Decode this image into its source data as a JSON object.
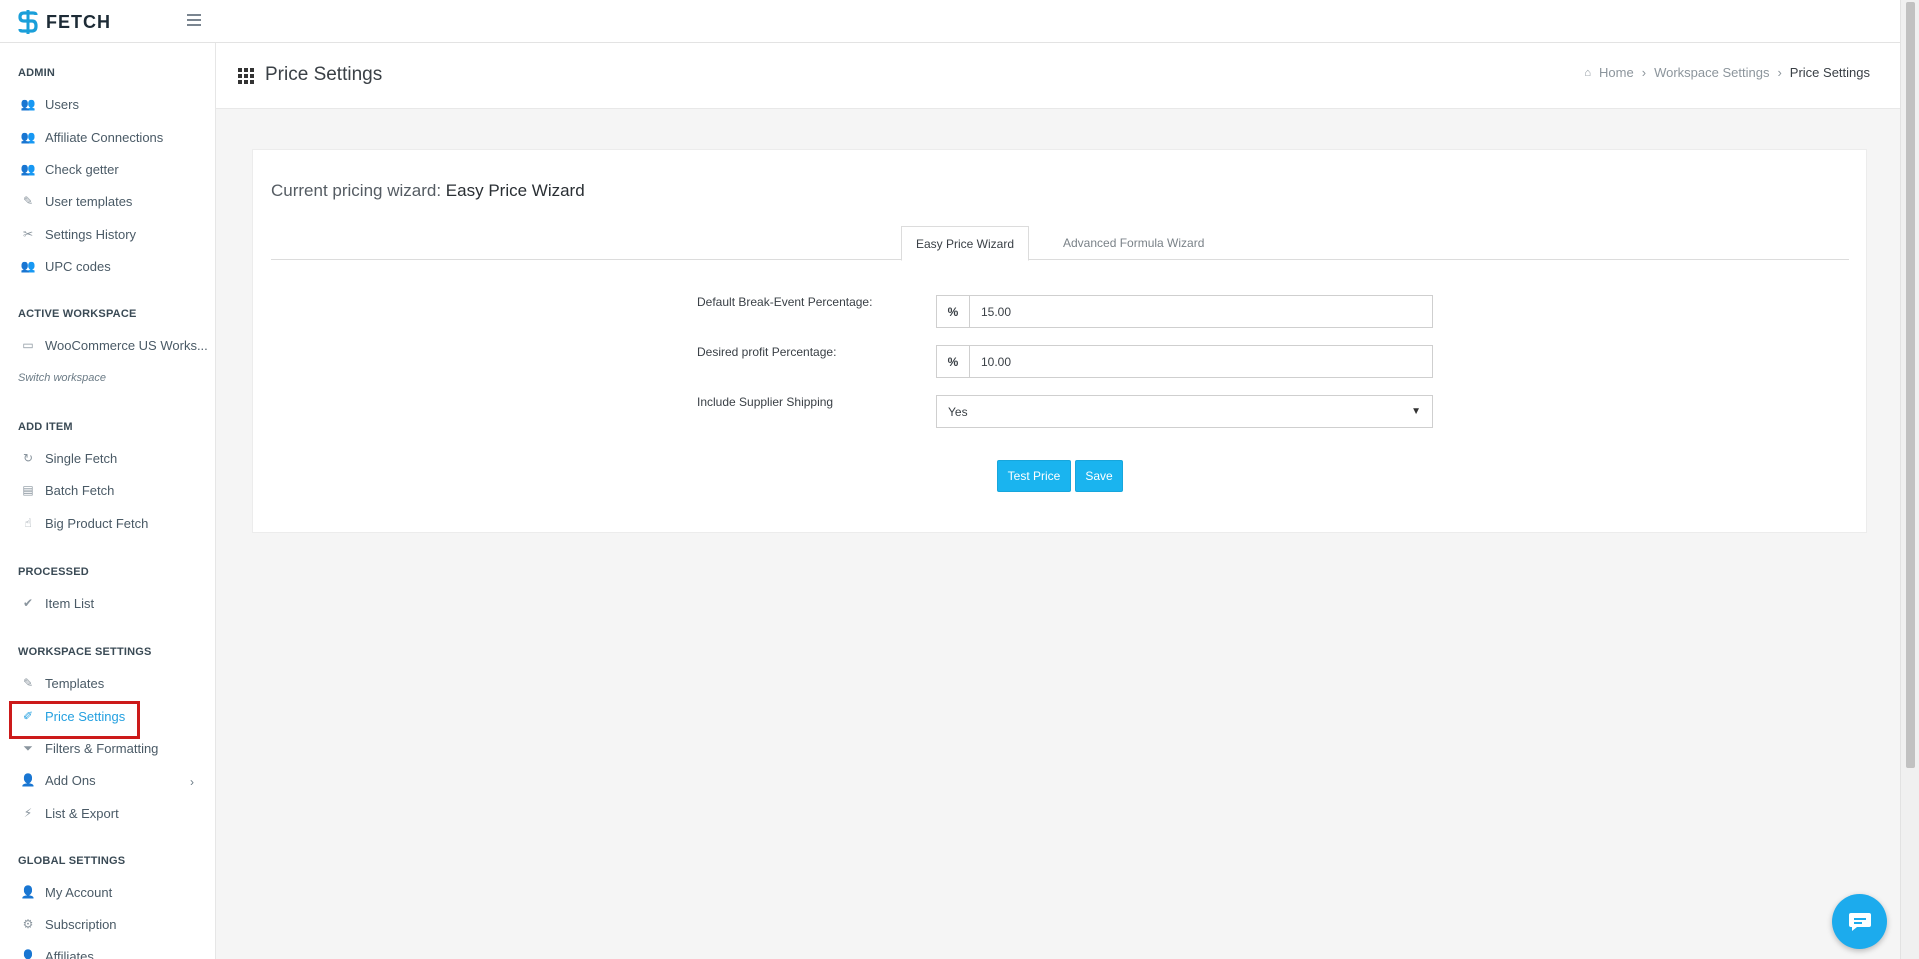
{
  "app": {
    "brand": "FETCH"
  },
  "sidebar": {
    "admin": {
      "title": "ADMIN",
      "items": [
        {
          "label": "Users",
          "icon": "users-icon"
        },
        {
          "label": "Affiliate Connections",
          "icon": "users-icon"
        },
        {
          "label": "Check getter",
          "icon": "users-icon"
        },
        {
          "label": "User templates",
          "icon": "brush-icon"
        },
        {
          "label": "Settings History",
          "icon": "tools-icon"
        },
        {
          "label": "UPC codes",
          "icon": "users-icon"
        }
      ]
    },
    "active_workspace": {
      "title": "ACTIVE WORKSPACE",
      "workspace_name": "WooCommerce US Works...",
      "switch_label": "Switch workspace"
    },
    "add_item": {
      "title": "ADD ITEM",
      "items": [
        {
          "label": "Single Fetch",
          "icon": "rotate-icon"
        },
        {
          "label": "Batch Fetch",
          "icon": "batch-icon"
        },
        {
          "label": "Big Product Fetch",
          "icon": "hand-icon"
        }
      ]
    },
    "processed": {
      "title": "PROCESSED",
      "items": [
        {
          "label": "Item List",
          "icon": "check-list-icon"
        }
      ]
    },
    "workspace_settings": {
      "title": "WORKSPACE SETTINGS",
      "items": [
        {
          "label": "Templates",
          "icon": "brush-icon"
        },
        {
          "label": "Price Settings",
          "icon": "money-icon"
        },
        {
          "label": "Filters & Formatting",
          "icon": "filter-icon"
        },
        {
          "label": "Add Ons",
          "icon": "user-plus-icon"
        },
        {
          "label": "List & Export",
          "icon": "wand-icon"
        }
      ]
    },
    "global_settings": {
      "title": "GLOBAL SETTINGS",
      "items": [
        {
          "label": "My Account",
          "icon": "user-icon"
        },
        {
          "label": "Subscription",
          "icon": "gear-icon"
        },
        {
          "label": "Affiliates",
          "icon": "user-icon"
        }
      ]
    }
  },
  "header": {
    "title": "Price Settings",
    "breadcrumb": {
      "home": "Home",
      "workspace_settings": "Workspace Settings",
      "current": "Price Settings"
    }
  },
  "main": {
    "wizard_prefix": "Current pricing wizard:",
    "wizard_name": "Easy Price Wizard",
    "tabs": [
      {
        "label": "Easy Price Wizard",
        "active": true
      },
      {
        "label": "Advanced Formula Wizard",
        "active": false
      }
    ],
    "form": {
      "break_even": {
        "label": "Default Break-Event Percentage:",
        "addon": "%",
        "value": "15.00"
      },
      "profit": {
        "label": "Desired profit Percentage:",
        "addon": "%",
        "value": "10.00"
      },
      "shipping": {
        "label": "Include Supplier Shipping",
        "value": "Yes"
      }
    },
    "buttons": {
      "test_price": "Test Price",
      "save": "Save"
    }
  },
  "colors": {
    "accent": "#1ab4ef",
    "active_nav": "#24a0e0",
    "highlight": "#cc1a1a"
  }
}
